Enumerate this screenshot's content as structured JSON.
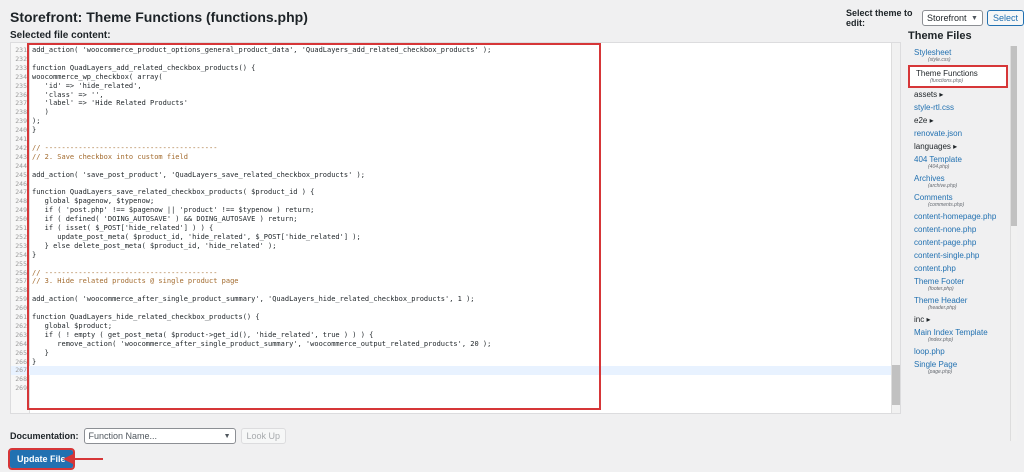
{
  "header": {
    "title": "Storefront: Theme Functions (functions.php)",
    "selected_label": "Selected file content:",
    "theme_select_label": "Select theme to edit:",
    "theme_value": "Storefront",
    "select_button": "Select"
  },
  "editor": {
    "lines": [
      {
        "n": "231",
        "t": "add_action( 'woocommerce_product_options_general_product_data', 'QuadLayers_add_related_checkbox_products' );"
      },
      {
        "n": "232",
        "t": ""
      },
      {
        "n": "233",
        "t": "function QuadLayers_add_related_checkbox_products() {"
      },
      {
        "n": "234",
        "t": "woocommerce_wp_checkbox( array("
      },
      {
        "n": "235",
        "t": "   'id' => 'hide_related',"
      },
      {
        "n": "236",
        "t": "   'class' => '',"
      },
      {
        "n": "237",
        "t": "   'label' => 'Hide Related Products'"
      },
      {
        "n": "238",
        "t": "   )"
      },
      {
        "n": "239",
        "t": ");"
      },
      {
        "n": "240",
        "t": "}"
      },
      {
        "n": "241",
        "t": ""
      },
      {
        "n": "242",
        "t": "// -----------------------------------------"
      },
      {
        "n": "243",
        "t": "// 2. Save checkbox into custom field"
      },
      {
        "n": "244",
        "t": ""
      },
      {
        "n": "245",
        "t": "add_action( 'save_post_product', 'QuadLayers_save_related_checkbox_products' );"
      },
      {
        "n": "246",
        "t": ""
      },
      {
        "n": "247",
        "t": "function QuadLayers_save_related_checkbox_products( $product_id ) {"
      },
      {
        "n": "248",
        "t": "   global $pagenow, $typenow;"
      },
      {
        "n": "249",
        "t": "   if ( 'post.php' !== $pagenow || 'product' !== $typenow ) return;"
      },
      {
        "n": "250",
        "t": "   if ( defined( 'DOING_AUTOSAVE' ) && DOING_AUTOSAVE ) return;"
      },
      {
        "n": "251",
        "t": "   if ( isset( $_POST['hide_related'] ) ) {"
      },
      {
        "n": "252",
        "t": "      update_post_meta( $product_id, 'hide_related', $_POST['hide_related'] );"
      },
      {
        "n": "253",
        "t": "   } else delete_post_meta( $product_id, 'hide_related' );"
      },
      {
        "n": "254",
        "t": "}"
      },
      {
        "n": "255",
        "t": ""
      },
      {
        "n": "256",
        "t": "// -----------------------------------------"
      },
      {
        "n": "257",
        "t": "// 3. Hide related products @ single product page"
      },
      {
        "n": "258",
        "t": ""
      },
      {
        "n": "259",
        "t": "add_action( 'woocommerce_after_single_product_summary', 'QuadLayers_hide_related_checkbox_products', 1 );"
      },
      {
        "n": "260",
        "t": ""
      },
      {
        "n": "261",
        "t": "function QuadLayers_hide_related_checkbox_products() {"
      },
      {
        "n": "262",
        "t": "   global $product;"
      },
      {
        "n": "263",
        "t": "   if ( ! empty ( get_post_meta( $product->get_id(), 'hide_related', true ) ) ) {"
      },
      {
        "n": "264",
        "t": "      remove_action( 'woocommerce_after_single_product_summary', 'woocommerce_output_related_products', 20 );"
      },
      {
        "n": "265",
        "t": "   }"
      },
      {
        "n": "266",
        "t": "}"
      },
      {
        "n": "267",
        "t": ""
      },
      {
        "n": "268",
        "t": ""
      },
      {
        "n": "269",
        "t": ""
      }
    ],
    "active_line": "267"
  },
  "documentation": {
    "label": "Documentation:",
    "placeholder": "Function Name...",
    "lookup_button": "Look Up"
  },
  "update_button": "Update File",
  "files": {
    "title": "Theme Files",
    "items": [
      {
        "name": "Stylesheet",
        "sub": "(style.css)",
        "dir": false
      },
      {
        "name": "Theme Functions",
        "sub": "(functions.php)",
        "dir": false,
        "active": true
      },
      {
        "name": "assets ▸",
        "sub": "",
        "dir": true
      },
      {
        "name": "style-rtl.css",
        "sub": "",
        "dir": false
      },
      {
        "name": "e2e ▸",
        "sub": "",
        "dir": true
      },
      {
        "name": "renovate.json",
        "sub": "",
        "dir": false
      },
      {
        "name": "languages ▸",
        "sub": "",
        "dir": true
      },
      {
        "name": "404 Template",
        "sub": "(404.php)",
        "dir": false
      },
      {
        "name": "Archives",
        "sub": "(archive.php)",
        "dir": false
      },
      {
        "name": "Comments",
        "sub": "(comments.php)",
        "dir": false
      },
      {
        "name": "content-homepage.php",
        "sub": "",
        "dir": false
      },
      {
        "name": "content-none.php",
        "sub": "",
        "dir": false
      },
      {
        "name": "content-page.php",
        "sub": "",
        "dir": false
      },
      {
        "name": "content-single.php",
        "sub": "",
        "dir": false
      },
      {
        "name": "content.php",
        "sub": "",
        "dir": false
      },
      {
        "name": "Theme Footer",
        "sub": "(footer.php)",
        "dir": false
      },
      {
        "name": "Theme Header",
        "sub": "(header.php)",
        "dir": false
      },
      {
        "name": "inc ▸",
        "sub": "",
        "dir": true
      },
      {
        "name": "Main Index Template",
        "sub": "(index.php)",
        "dir": false
      },
      {
        "name": "loop.php",
        "sub": "",
        "dir": false
      },
      {
        "name": "Single Page",
        "sub": "(page.php)",
        "dir": false
      }
    ]
  },
  "colors": {
    "accent": "#2271b1",
    "highlight": "#d63638",
    "comment": "#a36b2e",
    "string": "#a31515",
    "keyword": "#0000c0"
  }
}
